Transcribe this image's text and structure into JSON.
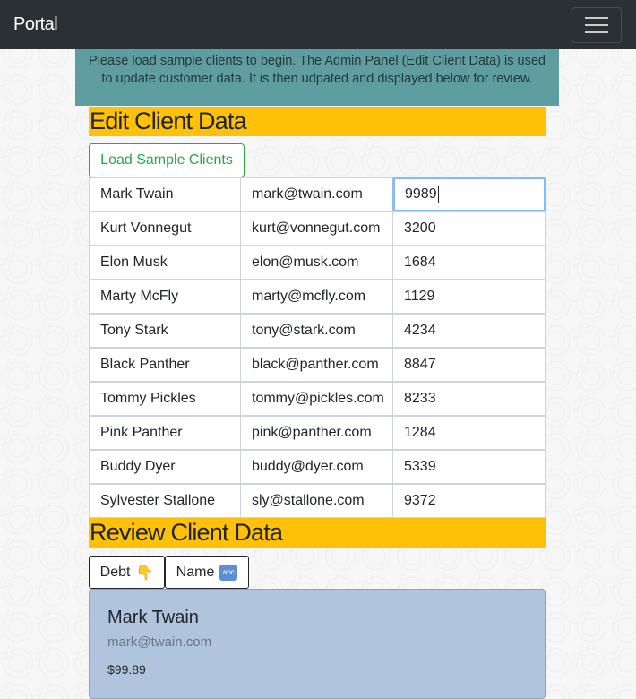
{
  "navbar": {
    "brand": "Portal",
    "menu_icon": "hamburger-icon"
  },
  "notice": "Please load sample clients to begin. The Admin Panel (Edit Client Data) is used to update customer data. It is then udpated and displayed below for review.",
  "edit": {
    "heading": "Edit Client Data",
    "load_button": "Load Sample Clients",
    "rows": [
      {
        "name": "Mark Twain",
        "email": "mark@twain.com",
        "amount": "9989"
      },
      {
        "name": "Kurt Vonnegut",
        "email": "kurt@vonnegut.com",
        "amount": "3200"
      },
      {
        "name": "Elon Musk",
        "email": "elon@musk.com",
        "amount": "1684"
      },
      {
        "name": "Marty McFly",
        "email": "marty@mcfly.com",
        "amount": "1129"
      },
      {
        "name": "Tony Stark",
        "email": "tony@stark.com",
        "amount": "4234"
      },
      {
        "name": "Black Panther",
        "email": "black@panther.com",
        "amount": "8847"
      },
      {
        "name": "Tommy Pickles",
        "email": "tommy@pickles.com",
        "amount": "8233"
      },
      {
        "name": "Pink Panther",
        "email": "pink@panther.com",
        "amount": "1284"
      },
      {
        "name": "Buddy Dyer",
        "email": "buddy@dyer.com",
        "amount": "5339"
      },
      {
        "name": "Sylvester Stallone",
        "email": "sly@stallone.com",
        "amount": "9372"
      }
    ]
  },
  "review": {
    "heading": "Review Client Data",
    "sort_debt": {
      "label": "Debt",
      "icon": "👇"
    },
    "sort_name": {
      "label": "Name",
      "icon": "abc"
    },
    "card": {
      "name": "Mark Twain",
      "email": "mark@twain.com",
      "debt": "$99.89"
    }
  }
}
